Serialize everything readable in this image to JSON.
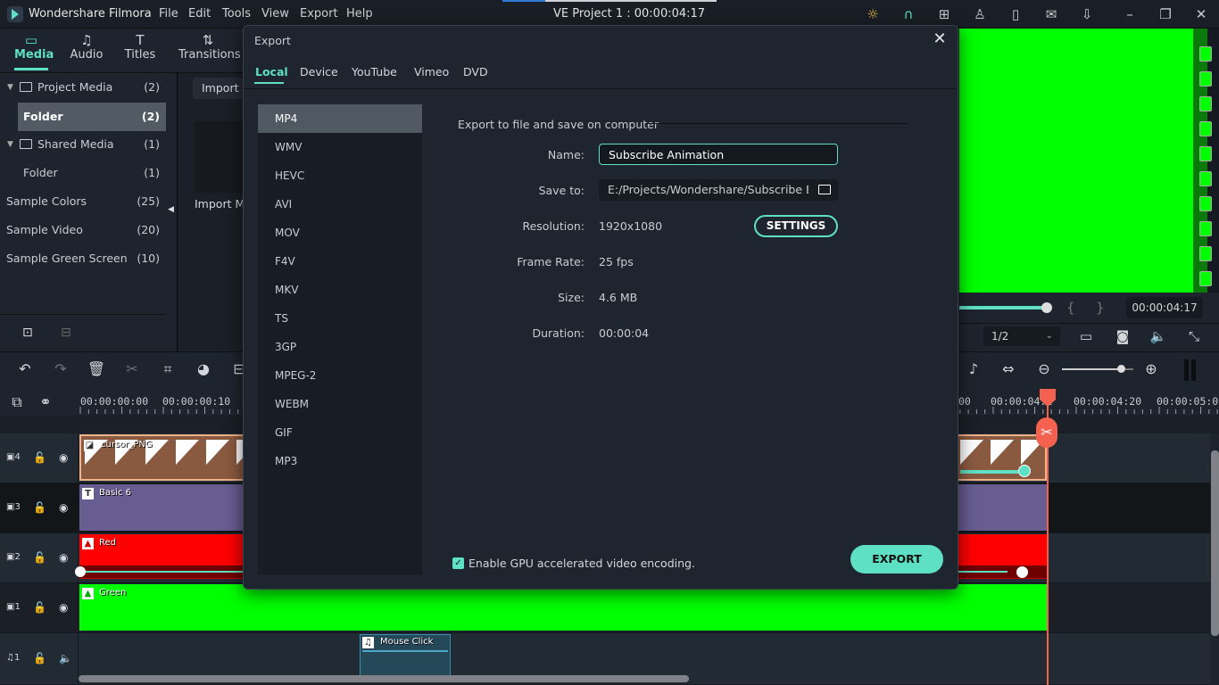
{
  "app": {
    "name": "Wondershare Filmora",
    "project_title": "VE Project 1 : 00:00:04:17",
    "menu": [
      "File",
      "Edit",
      "Tools",
      "View",
      "Export",
      "Help"
    ],
    "title_icons": [
      "bulb-icon",
      "headset-icon",
      "gift-icon",
      "user-icon",
      "save-icon",
      "mail-icon",
      "download-icon",
      "minimize-icon",
      "restore-icon",
      "close-icon"
    ]
  },
  "media_tabs": [
    {
      "label": "Media",
      "icon": "folder-icon",
      "active": true
    },
    {
      "label": "Audio",
      "icon": "music-note-icon"
    },
    {
      "label": "Titles",
      "icon": "text-icon"
    },
    {
      "label": "Transitions",
      "icon": "transition-icon"
    }
  ],
  "sidebar": {
    "items": [
      {
        "label": "Project Media",
        "count": "(2)",
        "expandable": true
      },
      {
        "label": "Folder",
        "count": "(2)",
        "selected": true
      },
      {
        "label": "Shared Media",
        "count": "(1)",
        "expandable": true
      },
      {
        "label": "Folder",
        "count": "(1)"
      },
      {
        "label": "Sample Colors",
        "count": "(25)"
      },
      {
        "label": "Sample Video",
        "count": "(20)"
      },
      {
        "label": "Sample Green Screen",
        "count": "(10)"
      }
    ]
  },
  "media_area": {
    "import_button": "Import",
    "import_label": "Import Media"
  },
  "player": {
    "timecode": "00:00:04:17",
    "quality": "1/2",
    "scrub_progress": 1.0
  },
  "timeline": {
    "ruler_labels_left": [
      "00:00:00:00",
      "00:00:00:10"
    ],
    "ruler_labels_right": [
      "00",
      "00:00:04:1",
      "00:00:04:20",
      "00:00:05:0"
    ],
    "zoom_level": 0.82,
    "tracks": [
      {
        "label": "4",
        "type": "video",
        "clip": "cursor_PNG"
      },
      {
        "label": "3",
        "type": "video",
        "clip": "Basic 6"
      },
      {
        "label": "2",
        "type": "video",
        "clip": "Red"
      },
      {
        "label": "1",
        "type": "video",
        "clip": "Green"
      },
      {
        "label": "1",
        "type": "audio",
        "clip": "Mouse Click"
      }
    ]
  },
  "dialog": {
    "title": "Export",
    "tabs": [
      "Local",
      "Device",
      "YouTube",
      "Vimeo",
      "DVD"
    ],
    "active_tab": "Local",
    "formats": [
      "MP4",
      "WMV",
      "HEVC",
      "AVI",
      "MOV",
      "F4V",
      "MKV",
      "TS",
      "3GP",
      "MPEG-2",
      "WEBM",
      "GIF",
      "MP3"
    ],
    "selected_format": "MP4",
    "section_title": "Export to file and save on computer",
    "fields": {
      "name_label": "Name:",
      "name_value": "Subscribe Animation",
      "saveto_label": "Save to:",
      "saveto_value": "E:/Projects/Wondershare/Subscribe Butt",
      "resolution_label": "Resolution:",
      "resolution_value": "1920x1080",
      "framerate_label": "Frame Rate:",
      "framerate_value": "25 fps",
      "size_label": "Size:",
      "size_value": "4.6 MB",
      "duration_label": "Duration:",
      "duration_value": "00:00:04"
    },
    "settings_button": "SETTINGS",
    "gpu_label": "Enable GPU accelerated video encoding.",
    "gpu_checked": true,
    "export_button": "EXPORT"
  },
  "colors": {
    "accent": "#5ee0c4",
    "playhead": "#f4624f",
    "green_clip": "#00ff00",
    "red_clip": "#ff0000",
    "title_clip": "#675d91"
  }
}
